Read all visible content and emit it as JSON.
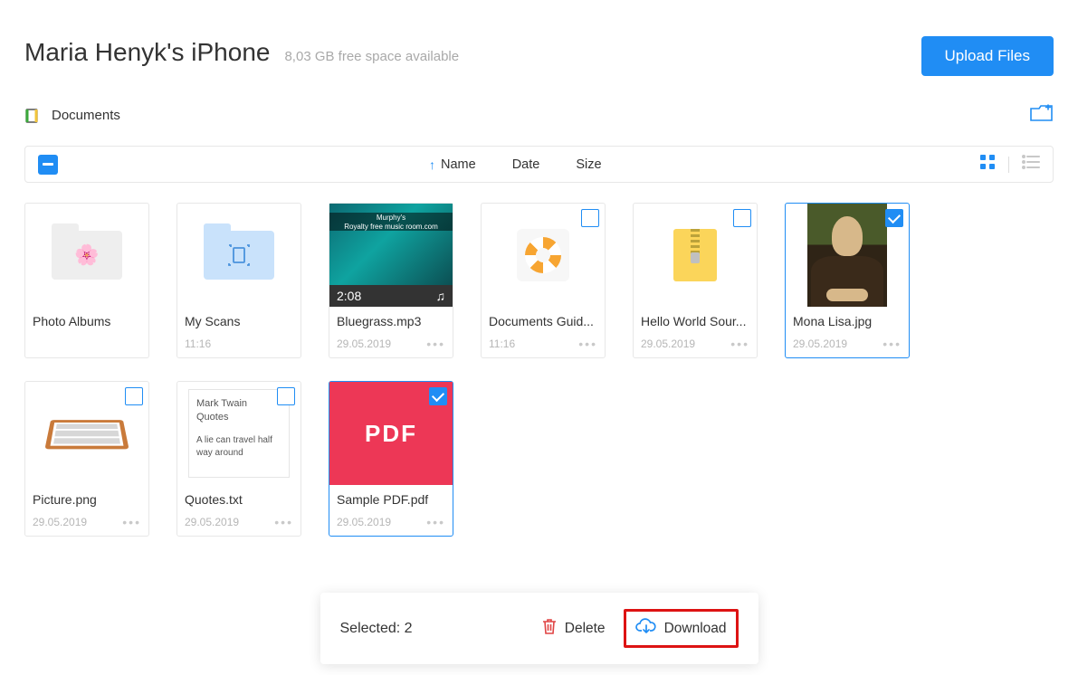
{
  "header": {
    "title": "Maria Henyk's iPhone",
    "free_space": "8,03 GB free space available",
    "upload_btn": "Upload Files"
  },
  "breadcrumb": {
    "label": "Documents"
  },
  "toolbar": {
    "sort_name": "Name",
    "sort_date": "Date",
    "sort_size": "Size"
  },
  "items": [
    {
      "name": "Photo Albums",
      "sub": "",
      "type": "folder-photo",
      "checkbox": false
    },
    {
      "name": "My Scans",
      "sub": "11:16",
      "type": "folder-scan",
      "checkbox": false
    },
    {
      "name": "Bluegrass.mp3",
      "sub": "29.05.2019",
      "type": "mp3",
      "checkbox": false,
      "mp3_time": "2:08",
      "mp3_band_top": "Murphy's",
      "mp3_band_bot": "Royalty free music room.com"
    },
    {
      "name": "Documents Guid...",
      "sub": "11:16",
      "type": "ring",
      "checkbox": true,
      "checked": false
    },
    {
      "name": "Hello World Sour...",
      "sub": "29.05.2019",
      "type": "zip",
      "checkbox": true,
      "checked": false
    },
    {
      "name": "Mona Lisa.jpg",
      "sub": "29.05.2019",
      "type": "mona",
      "checkbox": true,
      "checked": true
    },
    {
      "name": "Picture.png",
      "sub": "29.05.2019",
      "type": "picture",
      "checkbox": true,
      "checked": false
    },
    {
      "name": "Quotes.txt",
      "sub": "29.05.2019",
      "type": "txt",
      "checkbox": true,
      "checked": false,
      "txt_title": "Mark Twain Quotes",
      "txt_body": "A lie can travel half way around"
    },
    {
      "name": "Sample PDF.pdf",
      "sub": "29.05.2019",
      "type": "pdf",
      "checkbox": true,
      "checked": true,
      "pdf_label": "PDF"
    }
  ],
  "bottombar": {
    "selected": "Selected: 2",
    "delete": "Delete",
    "download": "Download"
  }
}
